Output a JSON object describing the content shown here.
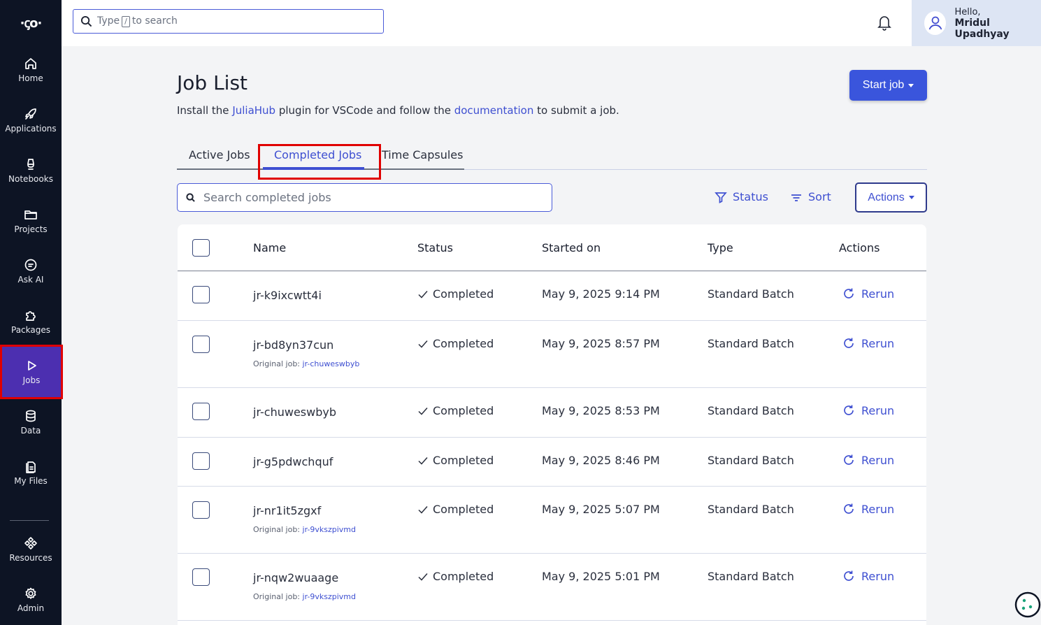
{
  "sidebar": {
    "logo": "·ꞔo·",
    "items": [
      {
        "label": "Home",
        "icon": "home-icon"
      },
      {
        "label": "Applications",
        "icon": "rocket-icon"
      },
      {
        "label": "Notebooks",
        "icon": "notebook-icon"
      },
      {
        "label": "Projects",
        "icon": "folder-icon"
      },
      {
        "label": "Ask AI",
        "icon": "chat-icon"
      },
      {
        "label": "Packages",
        "icon": "puzzle-icon"
      },
      {
        "label": "Jobs",
        "icon": "play-icon"
      },
      {
        "label": "Data",
        "icon": "database-icon"
      },
      {
        "label": "My Files",
        "icon": "files-icon"
      },
      {
        "label": "Resources",
        "icon": "resources-icon"
      },
      {
        "label": "Admin",
        "icon": "gear-icon"
      }
    ]
  },
  "topbar": {
    "search_prefix": "Type",
    "search_key": "/",
    "search_suffix": "to search",
    "greeting": "Hello,",
    "user_name": "Mridul Upadhyay"
  },
  "page": {
    "title": "Job List",
    "subtitle_pre": "Install the ",
    "subtitle_link1": "JuliaHub",
    "subtitle_mid": " plugin for VSCode and follow the ",
    "subtitle_link2": "documentation",
    "subtitle_post": " to submit a job.",
    "start_job_label": "Start job"
  },
  "tabs": [
    {
      "label": "Active Jobs"
    },
    {
      "label": "Completed Jobs"
    },
    {
      "label": "Time Capsules"
    }
  ],
  "toolbar": {
    "search_placeholder": "Search completed jobs",
    "status_label": "Status",
    "sort_label": "Sort",
    "actions_label": "Actions"
  },
  "table": {
    "headers": {
      "name": "Name",
      "status": "Status",
      "started": "Started on",
      "type": "Type",
      "actions": "Actions"
    },
    "rows": [
      {
        "name": "jr-k9ixcwtt4i",
        "status": "Completed",
        "started": "May 9, 2025 9:14 PM",
        "type": "Standard Batch",
        "action": "Rerun",
        "original_label": "",
        "original_job": ""
      },
      {
        "name": "jr-bd8yn37cun",
        "status": "Completed",
        "started": "May 9, 2025 8:57 PM",
        "type": "Standard Batch",
        "action": "Rerun",
        "original_label": "Original job: ",
        "original_job": "jr-chuweswbyb"
      },
      {
        "name": "jr-chuweswbyb",
        "status": "Completed",
        "started": "May 9, 2025 8:53 PM",
        "type": "Standard Batch",
        "action": "Rerun",
        "original_label": "",
        "original_job": ""
      },
      {
        "name": "jr-g5pdwchquf",
        "status": "Completed",
        "started": "May 9, 2025 8:46 PM",
        "type": "Standard Batch",
        "action": "Rerun",
        "original_label": "",
        "original_job": ""
      },
      {
        "name": "jr-nr1it5zgxf",
        "status": "Completed",
        "started": "May 9, 2025 5:07 PM",
        "type": "Standard Batch",
        "action": "Rerun",
        "original_label": "Original job: ",
        "original_job": "jr-9vkszpivmd"
      },
      {
        "name": "jr-nqw2wuaage",
        "status": "Completed",
        "started": "May 9, 2025 5:01 PM",
        "type": "Standard Batch",
        "action": "Rerun",
        "original_label": "Original job: ",
        "original_job": "jr-9vkszpivmd"
      }
    ]
  },
  "colors": {
    "sidebar_bg": "#0d1424",
    "active_nav": "#4c2fb0",
    "accent": "#3e4fd1",
    "primary_button": "#3a55dc",
    "highlight_box": "#e00000"
  }
}
